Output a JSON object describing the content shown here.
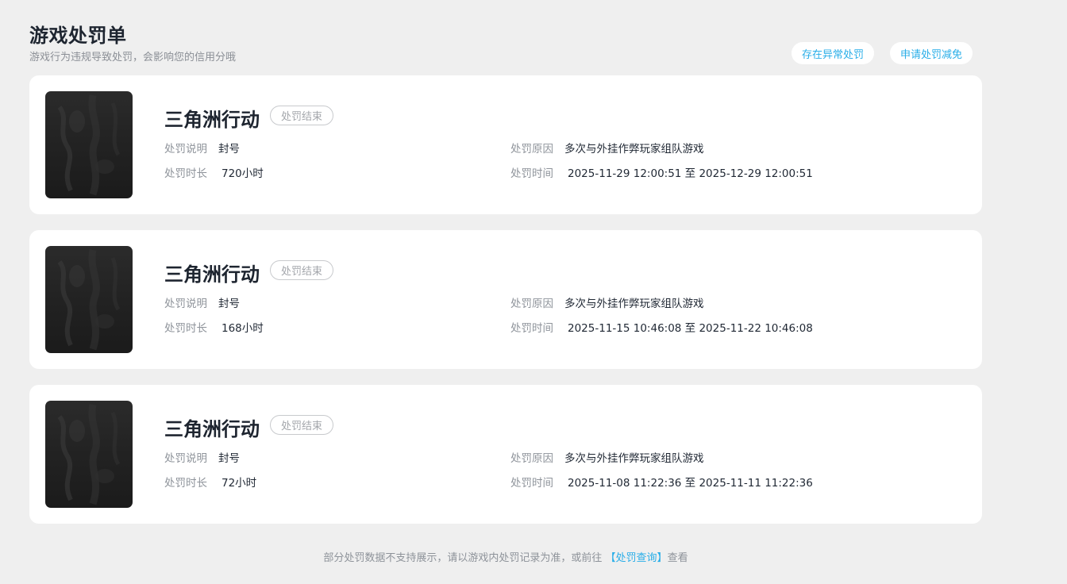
{
  "header": {
    "title": "游戏处罚单",
    "subtitle": "游戏行为违规导致处罚，会影响您的信用分哦"
  },
  "actions": {
    "abnormal_label": "存在异常处罚",
    "appeal_label": "申请处罚减免"
  },
  "labels": {
    "desc": "处罚说明",
    "duration": "处罚时长",
    "reason": "处罚原因",
    "time": "处罚时间"
  },
  "records": [
    {
      "game": "三角洲行动",
      "status": "处罚结束",
      "desc": "封号",
      "duration": "720小时",
      "reason": "多次与外挂作弊玩家组队游戏",
      "time": "2025-11-29 12:00:51 至 2025-12-29 12:00:51"
    },
    {
      "game": "三角洲行动",
      "status": "处罚结束",
      "desc": "封号",
      "duration": "168小时",
      "reason": "多次与外挂作弊玩家组队游戏",
      "time": "2025-11-15 10:46:08 至 2025-11-22 10:46:08"
    },
    {
      "game": "三角洲行动",
      "status": "处罚结束",
      "desc": "封号",
      "duration": "72小时",
      "reason": "多次与外挂作弊玩家组队游戏",
      "time": "2025-11-08 11:22:36 至 2025-11-11 11:22:36"
    }
  ],
  "footer": {
    "text_before": "部分处罚数据不支持展示，请以游戏内处罚记录为准，或前往 ",
    "link_text": "【处罚查询】",
    "text_after": "查看"
  }
}
